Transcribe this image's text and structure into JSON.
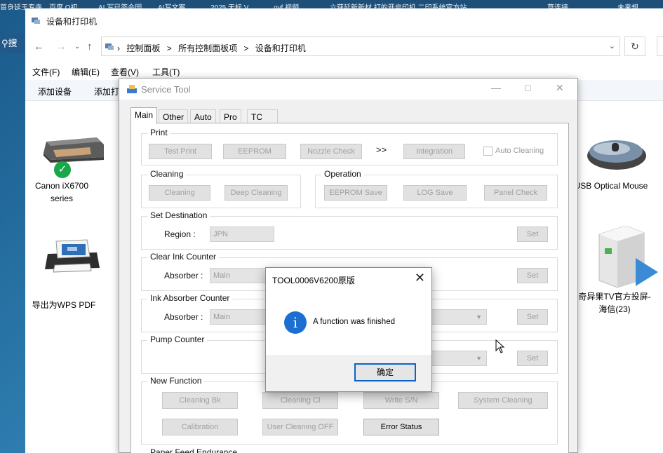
{
  "desktop": {
    "top_strip": [
      "首身延王专寺",
      "百度 O初",
      "AI 写已签会园",
      "AI写文案",
      "2025 无标 V",
      "ovf 视频",
      "六获延新新材 打的开启印机 二印系统官方站",
      "草连接",
      "未来规"
    ],
    "search_fragment": "搜索"
  },
  "explorer": {
    "title": "设备和打印机",
    "breadcrumbs": [
      "控制面板",
      ">",
      "所有控制面板项",
      ">",
      "设备和打印机"
    ],
    "menu": [
      "文件(F)",
      "编辑(E)",
      "查看(V)",
      "工具(T)"
    ],
    "commands": [
      "添加设备",
      "添加打"
    ],
    "devices": [
      {
        "name": "Canon iX6700 series",
        "icon": "printer-icon",
        "status": "default-check"
      },
      {
        "name": "导出为WPS PDF",
        "icon": "pdf-printer-icon"
      },
      {
        "name": "USB Optical Mouse",
        "icon": "mouse-icon"
      },
      {
        "name": "奇异果TV官方投屏-海信(23)",
        "icon": "media-device-icon"
      }
    ]
  },
  "service_tool": {
    "title": "Service Tool",
    "tabs": [
      "Main",
      "Other",
      "Auto",
      "Pro",
      "TC"
    ],
    "active_tab": "Main",
    "print": {
      "label": "Print",
      "buttons": [
        "Test Print",
        "EEPROM",
        "Nozzle Check",
        "Integration"
      ],
      "arrow": ">>",
      "auto_cleaning": "Auto Cleaning"
    },
    "cleaning": {
      "label": "Cleaning",
      "buttons": [
        "Cleaning",
        "Deep Cleaning"
      ]
    },
    "operation": {
      "label": "Operation",
      "buttons": [
        "EEPROM Save",
        "LOG Save",
        "Panel Check"
      ]
    },
    "set_destination": {
      "label": "Set Destination",
      "region_label": "Region :",
      "region_value": "JPN",
      "set": "Set"
    },
    "clear_ink_counter": {
      "label": "Clear Ink Counter",
      "absorber_label": "Absorber :",
      "absorber_value": "Main",
      "set": "Set"
    },
    "ink_absorber_counter": {
      "label": "Ink Absorber Counter",
      "absorber_label": "Absorber :",
      "absorber_value": "Main",
      "set": "Set"
    },
    "pump_counter": {
      "label": "Pump Counter",
      "set": "Set"
    },
    "new_function": {
      "label": "New Function",
      "row1": [
        "Cleaning Bk",
        "Cleaning Cl",
        "Write S/N",
        "System Cleaning"
      ],
      "row2": [
        "Calibration",
        "User Cleaning OFF",
        "Error Status"
      ]
    },
    "paper_feed": {
      "label": "Paper Feed Endurance"
    }
  },
  "dialog": {
    "title": "TOOL0006V6200原版",
    "message": "A function was finished",
    "ok": "确定",
    "close": "✕",
    "info_glyph": "i"
  }
}
